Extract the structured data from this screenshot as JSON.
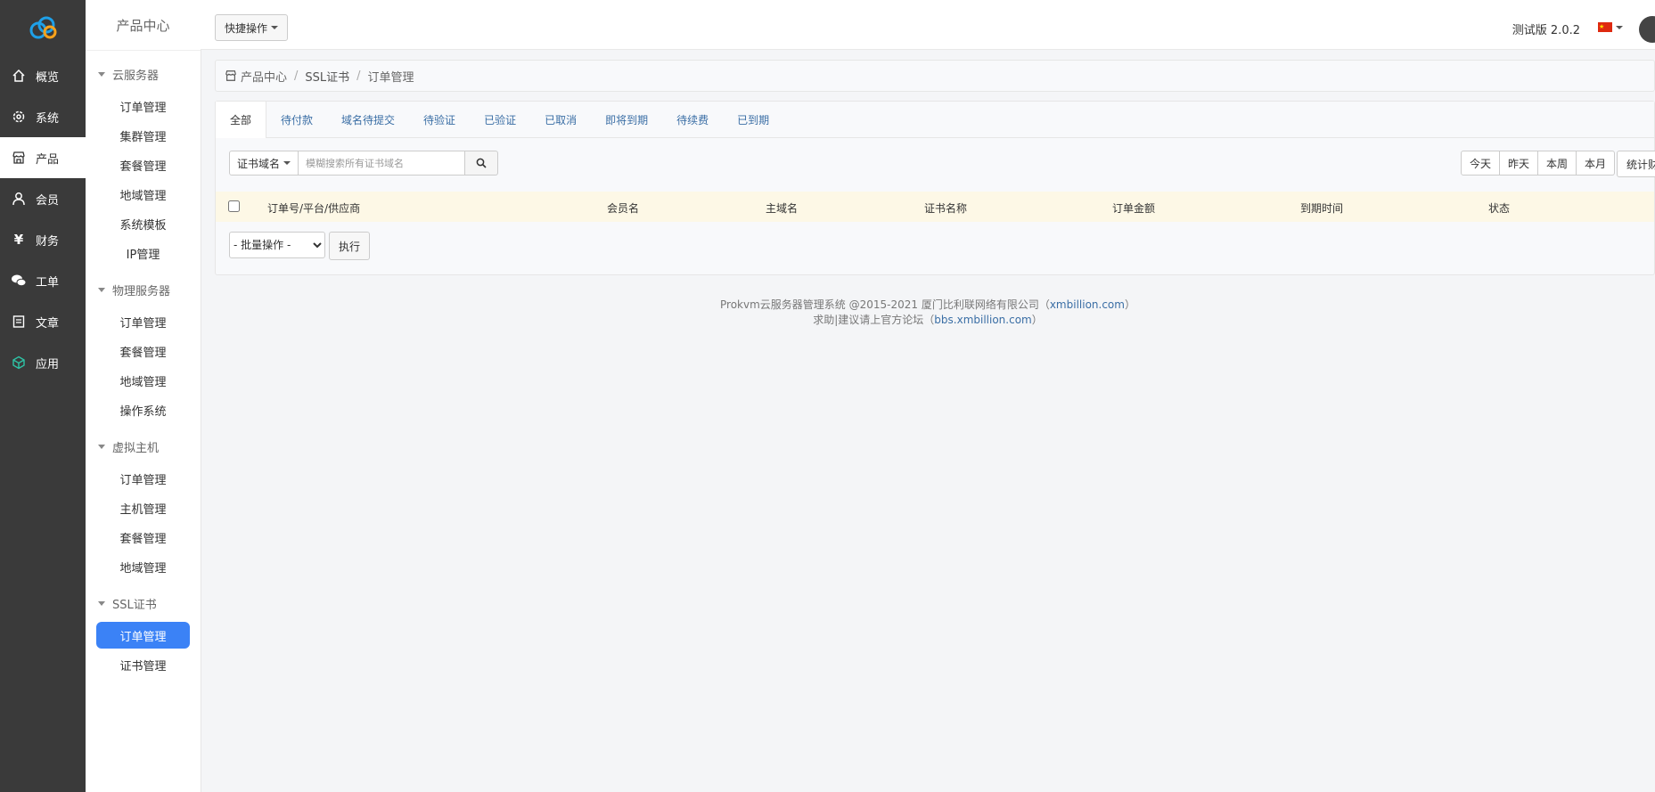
{
  "sidebar": {
    "items": [
      {
        "label": "概览",
        "icon": "home-icon"
      },
      {
        "label": "系统",
        "icon": "gear-icon"
      },
      {
        "label": "产品",
        "icon": "store-icon"
      },
      {
        "label": "会员",
        "icon": "user-icon"
      },
      {
        "label": "财务",
        "icon": "yen-icon"
      },
      {
        "label": "工单",
        "icon": "chat-icon"
      },
      {
        "label": "文章",
        "icon": "document-icon"
      },
      {
        "label": "应用",
        "icon": "cube-icon"
      }
    ],
    "active_index": 2
  },
  "submenu": {
    "title": "产品中心",
    "groups": [
      {
        "title": "云服务器",
        "items": [
          "订单管理",
          "集群管理",
          "套餐管理",
          "地域管理",
          "系统模板",
          "IP管理"
        ]
      },
      {
        "title": "物理服务器",
        "items": [
          "订单管理",
          "套餐管理",
          "地域管理",
          "操作系统"
        ]
      },
      {
        "title": "虚拟主机",
        "items": [
          "订单管理",
          "主机管理",
          "套餐管理",
          "地域管理"
        ]
      },
      {
        "title": "SSL证书",
        "items": [
          "订单管理",
          "证书管理"
        ]
      }
    ],
    "active": "SSL证书/订单管理"
  },
  "header": {
    "quick_action": "快捷操作",
    "version": "测试版 2.0.2",
    "brand_color": "#3b82f6"
  },
  "breadcrumb": {
    "items": [
      "产品中心",
      "SSL证书",
      "订单管理"
    ]
  },
  "tabs": [
    "全部",
    "待付款",
    "域名待提交",
    "待验证",
    "已验证",
    "已取消",
    "即将到期",
    "待续费",
    "已到期"
  ],
  "toolbar": {
    "filter_select": "证书域名",
    "search_placeholder": "模糊搜索所有证书域名",
    "date_buttons": [
      "今天",
      "昨天",
      "本周",
      "本月"
    ],
    "stats_button": "统计财"
  },
  "table": {
    "columns": [
      "订单号/平台/供应商",
      "会员名",
      "主域名",
      "证书名称",
      "订单金额",
      "到期时间",
      "状态"
    ]
  },
  "batch": {
    "select_label": "- 批量操作 -",
    "execute_label": "执行"
  },
  "footer": {
    "line1_prefix": "Prokvm云服务器管理系统 @2015-2021 厦门比利联网络有限公司（",
    "line1_link": "xmbillion.com",
    "line1_suffix": "）",
    "line2_prefix": "求助|建议请上官方论坛（",
    "line2_link": "bbs.xmbillion.com",
    "line2_suffix": "）"
  }
}
